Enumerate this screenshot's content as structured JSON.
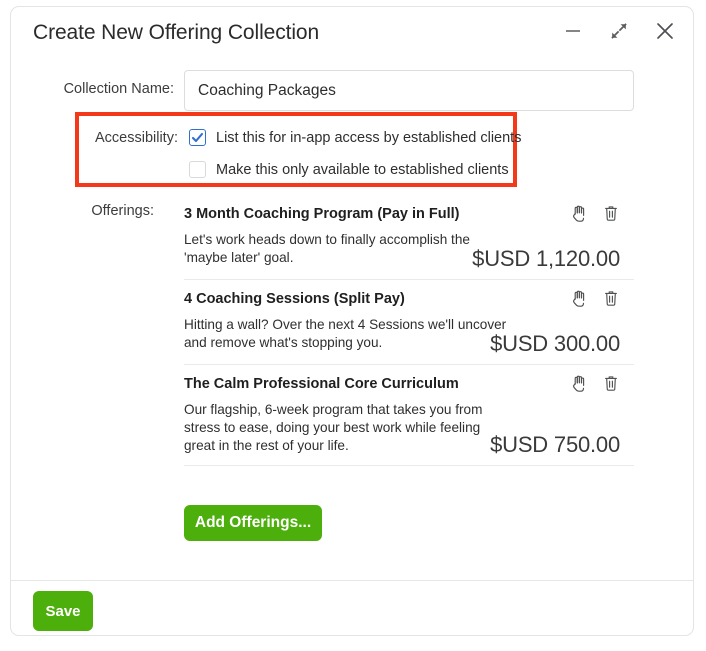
{
  "window": {
    "title": "Create New Offering Collection",
    "controls": [
      {
        "name": "minimize-icon",
        "label": "Minimize"
      },
      {
        "name": "restore-icon",
        "label": "Restore Down"
      },
      {
        "name": "close-icon",
        "label": "Close"
      }
    ]
  },
  "form": {
    "collection_name_label": "Collection Name:",
    "collection_name_value": "Coaching Packages",
    "collection_name_placeholder": "Collection Name",
    "accessibility_label": "Accessibility:",
    "accessibility_options": [
      {
        "label": "List this for in-app access by established clients",
        "checked": true
      },
      {
        "label": "Make this only available to established clients",
        "checked": false
      }
    ],
    "offerings_label": "Offerings:"
  },
  "offerings": [
    {
      "title": "3 Month Coaching Program (Pay in Full)",
      "description": "Let's work heads down to finally accomplish the\n'maybe later' goal.",
      "price": "$USD 1,120.00"
    },
    {
      "title": "4 Coaching Sessions (Split Pay)",
      "description": "Hitting a wall? Over the next 4 Sessions we'll uncover\nand remove what's stopping you.",
      "price": "$USD 300.00"
    },
    {
      "title": "The Calm Professional Core Curriculum",
      "description": "Our flagship, 6-week program that takes you from\nstress to ease, doing your best work while feeling\ngreat in the rest of your life.",
      "price": "$USD 750.00"
    }
  ],
  "buttons": {
    "add_offerings": "Add Offerings...",
    "save": "Save"
  },
  "colors": {
    "accent_green": "#4caf0b",
    "highlight_red": "#f4391a",
    "checkbox_blue": "#2f6fd0"
  }
}
